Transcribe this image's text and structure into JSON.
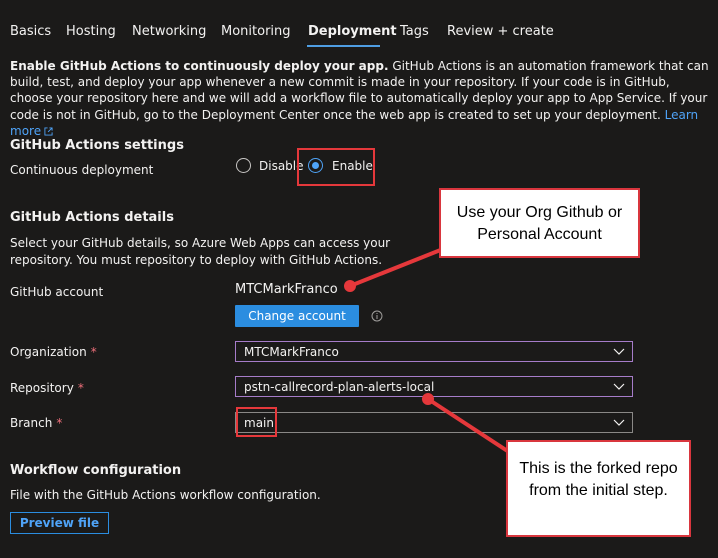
{
  "tabs": [
    {
      "label": "Basics"
    },
    {
      "label": "Hosting"
    },
    {
      "label": "Networking"
    },
    {
      "label": "Monitoring"
    },
    {
      "label": "Deployment"
    },
    {
      "label": "Tags"
    },
    {
      "label": "Review + create"
    }
  ],
  "active_tab": "Deployment",
  "intro": {
    "bold": "Enable GitHub Actions to continuously deploy your app.",
    "text": " GitHub Actions is an automation framework that can build, test, and deploy your app whenever a new commit is made in your repository. If your code is in GitHub, choose your repository here and we will add a workflow file to automatically deploy your app to App Service. If your code is not in GitHub, go to the Deployment Center once the web app is created to set up your deployment.",
    "link": "Learn more"
  },
  "settings": {
    "title": "GitHub Actions settings",
    "cd_label": "Continuous deployment",
    "disable_label": "Disable",
    "enable_label": "Enable",
    "selected": "Enable"
  },
  "details": {
    "title": "GitHub Actions details",
    "desc": "Select your GitHub details, so Azure Web Apps can access your repository. You must repository to deploy with GitHub Actions.",
    "account_label": "GitHub account",
    "account_value": "MTCMarkFranco",
    "change_button": "Change account",
    "org_label": "Organization",
    "org_value": "MTCMarkFranco",
    "repo_label": "Repository",
    "repo_value": "pstn-callrecord-plan-alerts-local",
    "branch_label": "Branch",
    "branch_value": "main",
    "required_mark": "*"
  },
  "workflow": {
    "title": "Workflow configuration",
    "desc": "File with the GitHub Actions workflow configuration.",
    "preview_button": "Preview file"
  },
  "callouts": {
    "top": "Use your Org Github or Personal Account",
    "bottom": "This is the forked repo from the initial step."
  },
  "colors": {
    "background": "#1b1a19",
    "accent": "#2b8de0",
    "link": "#4fa3f7",
    "annotation_red": "#e5383b",
    "focus_purple": "#a67cc9"
  }
}
